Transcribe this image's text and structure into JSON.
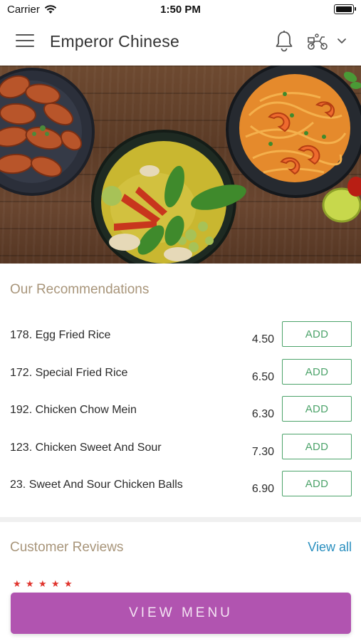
{
  "status_bar": {
    "carrier": "Carrier",
    "time": "1:50 PM"
  },
  "header": {
    "title": "Emperor Chinese"
  },
  "recommendations": {
    "title": "Our Recommendations",
    "items": [
      {
        "name": "178. Egg Fried Rice",
        "price": "4.50",
        "action": "ADD"
      },
      {
        "name": "172. Special Fried Rice",
        "price": "6.50",
        "action": "ADD"
      },
      {
        "name": "192. Chicken Chow Mein",
        "price": "6.30",
        "action": "ADD"
      },
      {
        "name": "123. Chicken Sweet And Sour",
        "price": "7.30",
        "action": "ADD"
      },
      {
        "name": "23. Sweet And Sour Chicken Balls",
        "price": "6.90",
        "action": "ADD"
      }
    ]
  },
  "reviews": {
    "title": "Customer Reviews",
    "view_all": "View all",
    "rating_stars": 5
  },
  "footer": {
    "view_menu_label": "VIEW MENU"
  },
  "colors": {
    "accent": "#b154b0",
    "add_green": "#4ca36a",
    "section_title": "#a8957a",
    "link": "#2a8fbf",
    "star": "#e0342d"
  },
  "icons": [
    "wifi-icon",
    "battery-icon",
    "hamburger-menu-icon",
    "bell-icon",
    "scooter-delivery-icon",
    "chevron-down-icon",
    "star-icon"
  ]
}
